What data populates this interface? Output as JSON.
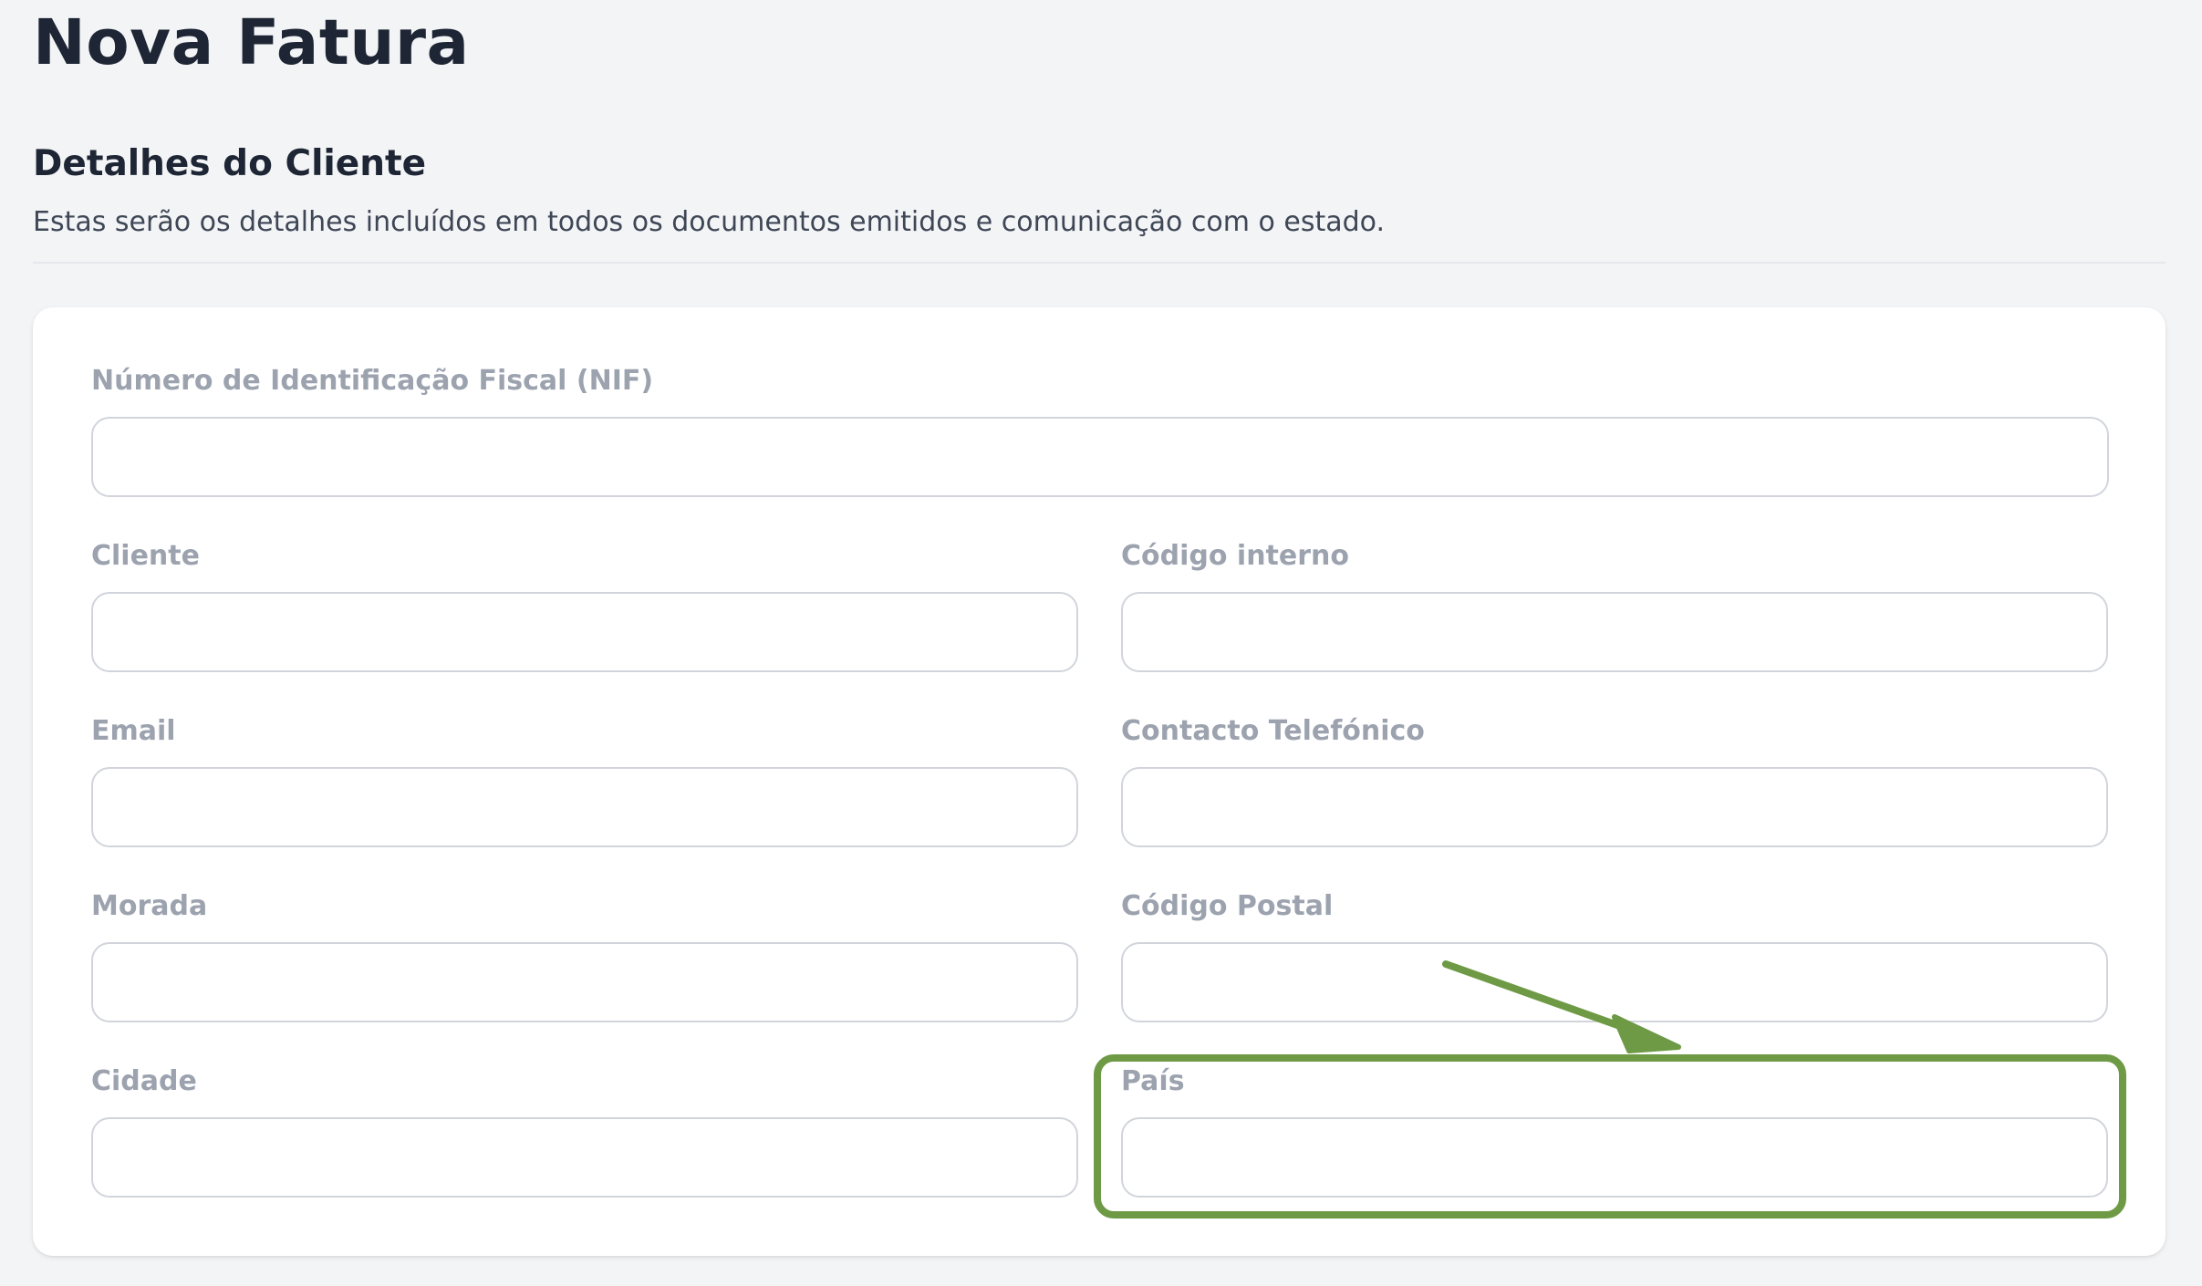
{
  "page": {
    "title": "Nova Fatura"
  },
  "section": {
    "title": "Detalhes do Cliente",
    "subtitle": "Estas serão os detalhes incluídos em todos os documentos emitidos e comunicação com o estado."
  },
  "form": {
    "nif_label": "Número de Identificação Fiscal (NIF)",
    "nif_value": "",
    "cliente_label": "Cliente",
    "cliente_value": "",
    "codigo_interno_label": "Código interno",
    "codigo_interno_value": "",
    "email_label": "Email",
    "email_value": "",
    "contacto_label": "Contacto Telefónico",
    "contacto_value": "",
    "morada_label": "Morada",
    "morada_value": "",
    "codigo_postal_label": "Código Postal",
    "codigo_postal_value": "",
    "cidade_label": "Cidade",
    "cidade_value": "",
    "pais_label": "País",
    "pais_value": ""
  },
  "annotation": {
    "color": "#6e9a46"
  }
}
